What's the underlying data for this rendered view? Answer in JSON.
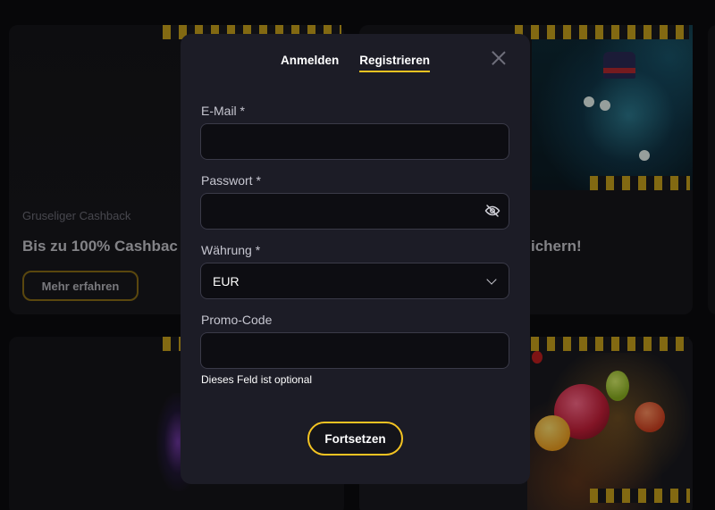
{
  "background": {
    "cards": [
      {
        "subtitle": "Gruseliger Cashback",
        "title": "Bis zu 100% Cashbac",
        "button_label": "Mehr erfahren"
      },
      {
        "title": "ichern!"
      }
    ]
  },
  "modal": {
    "tabs": [
      {
        "label": "Anmelden",
        "active": false
      },
      {
        "label": "Registrieren",
        "active": true
      }
    ],
    "close_icon": "close-icon",
    "fields": {
      "email": {
        "label": "E-Mail *",
        "value": "",
        "placeholder": ""
      },
      "password": {
        "label": "Passwort *",
        "value": "",
        "placeholder": "",
        "icon": "eye-off-icon"
      },
      "currency": {
        "label": "Währung *",
        "selected": "EUR",
        "icon": "chevron-down-icon"
      },
      "promo": {
        "label": "Promo-Code",
        "value": "",
        "placeholder": "",
        "hint": "Dieses Feld ist optional"
      }
    },
    "submit_label": "Fortsetzen"
  },
  "colors": {
    "accent": "#f3c322",
    "modal_bg": "#1c1c26",
    "field_bg": "#0d0d12"
  }
}
